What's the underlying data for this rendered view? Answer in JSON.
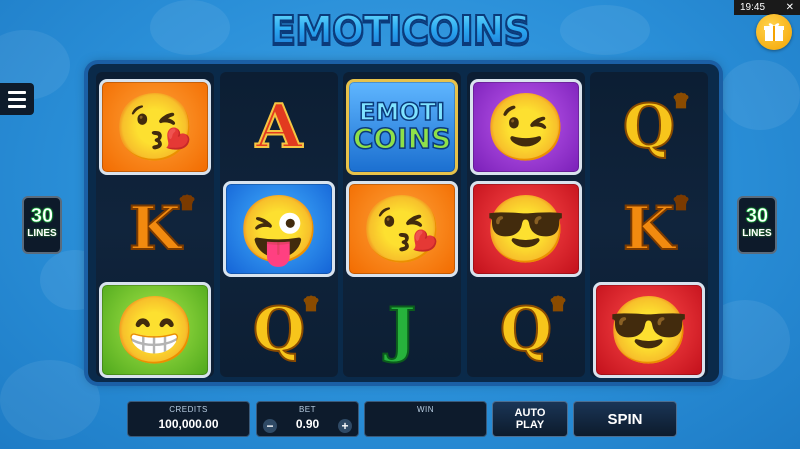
{
  "status": {
    "time": "19:45",
    "close_glyph": "✕"
  },
  "logo": {
    "text": "EMOTICOINS"
  },
  "lines_left": {
    "number": "30",
    "label": "LINES"
  },
  "lines_right": {
    "number": "30",
    "label": "LINES"
  },
  "reels": [
    [
      {
        "type": "emoji",
        "variant": "kiss-wink",
        "bg": "orange",
        "glyph": "😘"
      },
      {
        "type": "letter",
        "value": "K",
        "style": "orange",
        "crown": true
      },
      {
        "type": "emoji",
        "variant": "grin",
        "bg": "green",
        "glyph": "😁"
      }
    ],
    [
      {
        "type": "letter",
        "value": "A",
        "style": "red",
        "crown": false
      },
      {
        "type": "emoji",
        "variant": "tongue-wink",
        "bg": "blue",
        "glyph": "😜"
      },
      {
        "type": "letter",
        "value": "Q",
        "style": "gold",
        "crown": true
      }
    ],
    [
      {
        "type": "logo",
        "line1": "EMOTI",
        "line2": "COINS",
        "bg": "logo-tile"
      },
      {
        "type": "emoji",
        "variant": "kiss-wink",
        "bg": "orange",
        "glyph": "😘"
      },
      {
        "type": "letter",
        "value": "J",
        "style": "green",
        "crown": false
      }
    ],
    [
      {
        "type": "emoji",
        "variant": "wink",
        "bg": "purple",
        "glyph": "😉"
      },
      {
        "type": "emoji",
        "variant": "sunglasses",
        "bg": "red",
        "glyph": "😎"
      },
      {
        "type": "letter",
        "value": "Q",
        "style": "gold",
        "crown": true
      }
    ],
    [
      {
        "type": "letter",
        "value": "Q",
        "style": "gold",
        "crown": true
      },
      {
        "type": "letter",
        "value": "K",
        "style": "orange",
        "crown": true
      },
      {
        "type": "emoji",
        "variant": "sunglasses",
        "bg": "red",
        "glyph": "😎"
      }
    ]
  ],
  "bottom": {
    "credits_label": "CREDITS",
    "credits_value": "100,000.00",
    "bet_label": "BET",
    "bet_value": "0.90",
    "bet_minus": "−",
    "bet_plus": "+",
    "win_label": "WIN",
    "win_value": "",
    "autoplay_label_1": "AUTO",
    "autoplay_label_2": "PLAY",
    "spin_label": "SPIN"
  }
}
